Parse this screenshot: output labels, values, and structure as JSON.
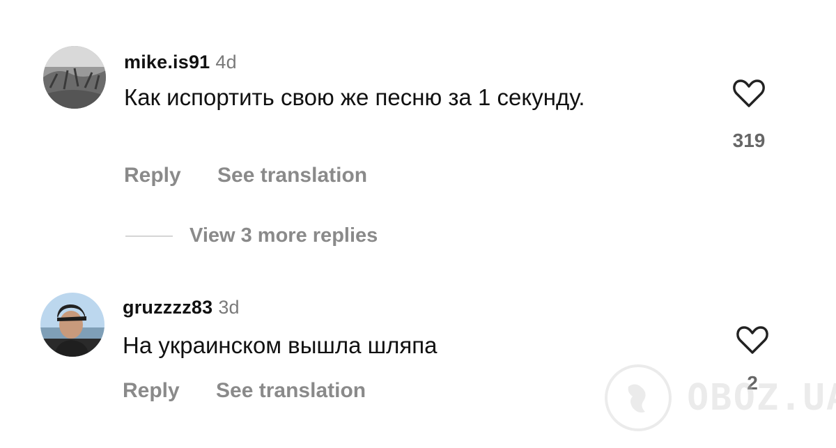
{
  "comments": [
    {
      "username": "mike.is91",
      "time": "4d",
      "text": "Как испортить свою же песню за 1 секунду.",
      "reply_label": "Reply",
      "translate_label": "See translation",
      "likes": "319"
    },
    {
      "username": "gruzzzz83",
      "time": "3d",
      "text": "На украинском вышла шляпа",
      "reply_label": "Reply",
      "translate_label": "See translation",
      "likes": "2"
    }
  ],
  "view_more": "View 3 more replies",
  "watermark": "OBOZ.UA",
  "icons": {
    "like": "heart-outline-icon",
    "watermark_logo": "globe-icon"
  },
  "colors": {
    "text": "#111111",
    "muted": "#8a8a8a",
    "divider": "#d5d5d5"
  }
}
